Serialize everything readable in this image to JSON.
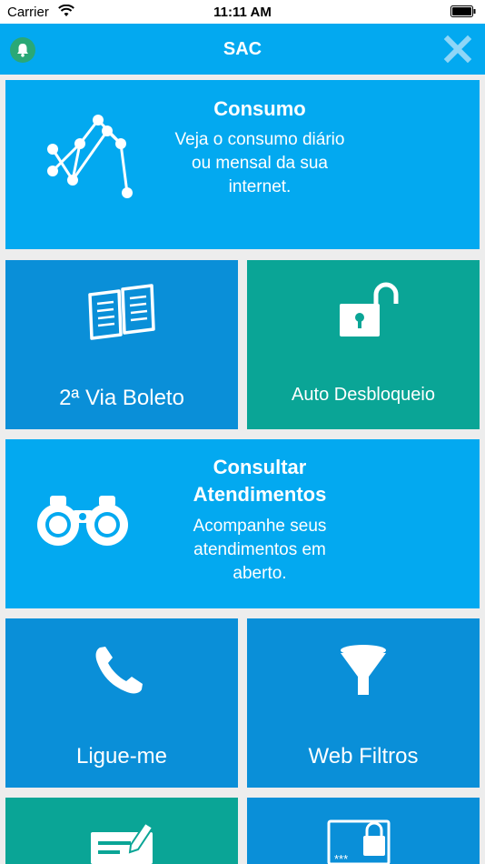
{
  "status_bar": {
    "carrier": "Carrier",
    "time": "11:11 AM"
  },
  "nav": {
    "title": "SAC",
    "left_icon": "bell-icon",
    "right_icon": "close-icon"
  },
  "colors": {
    "nav": "#03a9f0",
    "tile_light_blue": "#03a9f0",
    "tile_dark_blue": "#0a8fd8",
    "tile_teal": "#0aa596",
    "bell_badge": "#2aa876",
    "background": "#ededed"
  },
  "tiles": {
    "consumo": {
      "title": "Consumo",
      "description": "Veja o consumo diário ou mensal da sua internet.",
      "icon": "network-graph-icon"
    },
    "boleto": {
      "label": "2ª Via Boleto",
      "icon": "document-icon"
    },
    "desbloqueio": {
      "label": "Auto Desbloqueio",
      "icon": "unlock-icon"
    },
    "atendimentos": {
      "title": "Consultar Atendimentos",
      "description": "Acompanhe seus atendimentos em aberto.",
      "icon": "binoculars-icon"
    },
    "ligue": {
      "label": "Ligue-me",
      "icon": "phone-icon"
    },
    "filtros": {
      "label": "Web Filtros",
      "icon": "funnel-icon"
    },
    "bottom_left": {
      "icon": "edit-form-icon"
    },
    "bottom_right": {
      "icon": "password-lock-icon"
    }
  }
}
